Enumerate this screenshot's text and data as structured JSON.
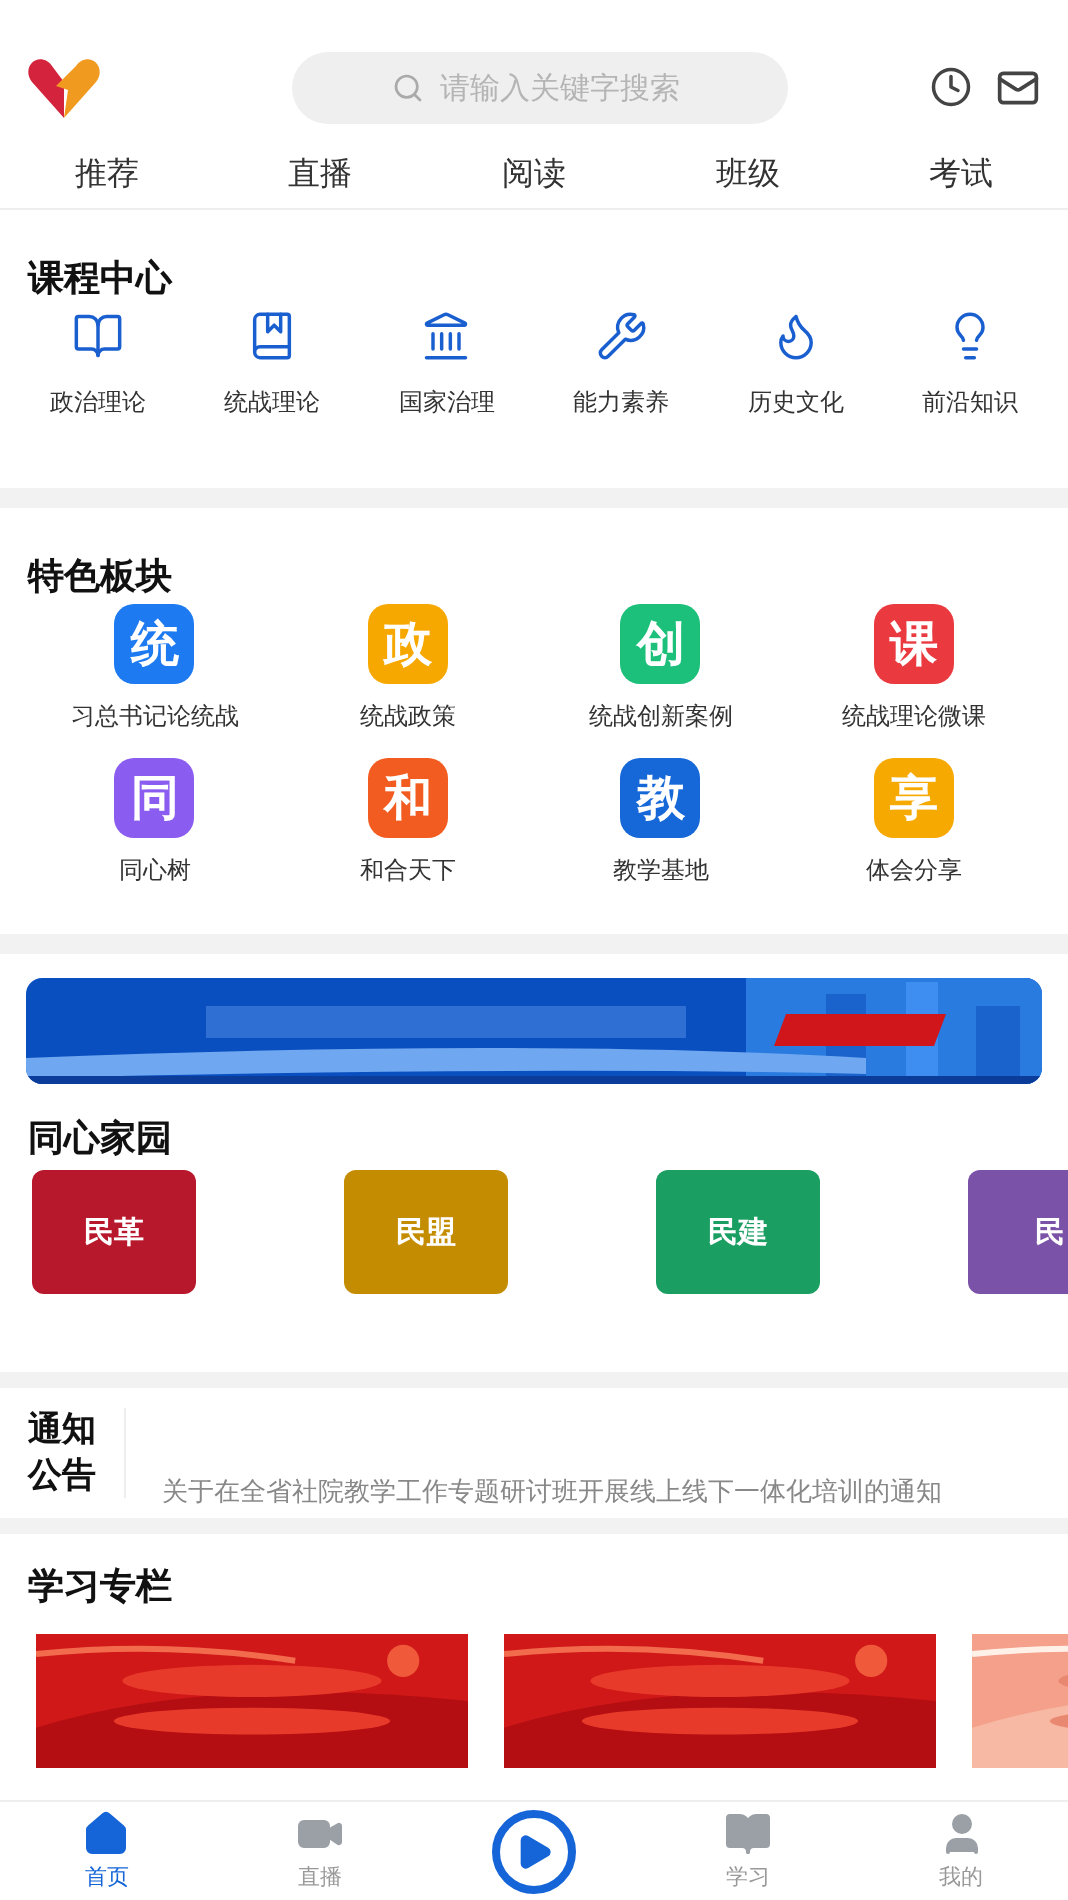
{
  "search": {
    "placeholder": "请输入关键字搜索"
  },
  "tabs": [
    {
      "label": "推荐",
      "selected": false
    },
    {
      "label": "直播",
      "selected": false
    },
    {
      "label": "阅读",
      "selected": false
    },
    {
      "label": "班级",
      "selected": false
    },
    {
      "label": "考试",
      "selected": false
    }
  ],
  "course_center": {
    "title": "课程中心",
    "items": [
      {
        "label": "政治理论",
        "kind": "book"
      },
      {
        "label": "统战理论",
        "kind": "starbook"
      },
      {
        "label": "国家治理",
        "kind": "hall"
      },
      {
        "label": "能力素养",
        "kind": "tools"
      },
      {
        "label": "历史文化",
        "kind": "dragon"
      },
      {
        "label": "前沿知识",
        "kind": "bulb"
      }
    ]
  },
  "featured": {
    "title": "特色板块",
    "items": [
      {
        "glyph": "统",
        "label": "习总书记论统战",
        "color": "#1d7af0"
      },
      {
        "glyph": "政",
        "label": "统战政策",
        "color": "#f7a800"
      },
      {
        "glyph": "创",
        "label": "统战创新案例",
        "color": "#1cc07a"
      },
      {
        "glyph": "课",
        "label": "统战理论微课",
        "color": "#ea3a3f"
      },
      {
        "glyph": "同",
        "label": "同心树",
        "color": "#8b5cf0"
      },
      {
        "glyph": "和",
        "label": "和合天下",
        "color": "#f25c20"
      },
      {
        "glyph": "教",
        "label": "教学基地",
        "color": "#1668d8"
      },
      {
        "glyph": "享",
        "label": "体会分享",
        "color": "#f6a900"
      }
    ]
  },
  "home": {
    "title": "同心家园",
    "items": [
      {
        "label": "民革",
        "color": "#b8182c"
      },
      {
        "label": "民盟",
        "color": "#c48c00"
      },
      {
        "label": "民建",
        "color": "#1a9e62"
      },
      {
        "label": "民",
        "color": "#7a52a8"
      }
    ]
  },
  "notice": {
    "title": "通知公告",
    "items": [
      "关于在全省社院教学工作专题研讨班开展线上线下一体化培训的通知"
    ]
  },
  "study": {
    "title": "学习专栏"
  },
  "bottom_nav": [
    {
      "label": "首页",
      "kind": "home",
      "selected": true
    },
    {
      "label": "直播",
      "kind": "video",
      "selected": false
    },
    {
      "kind": "play",
      "selected": false
    },
    {
      "label": "学习",
      "kind": "book",
      "selected": false
    },
    {
      "label": "我的",
      "kind": "user",
      "selected": false
    }
  ]
}
